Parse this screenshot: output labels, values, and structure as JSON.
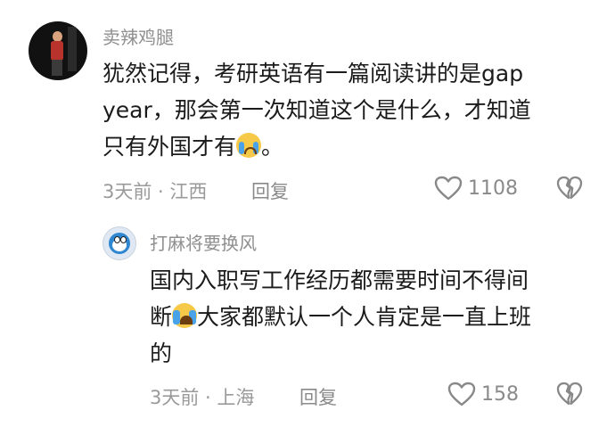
{
  "comment": {
    "username": "卖辣鸡腿",
    "text_line1": "犹然记得，考研英语有一篇阅读讲的是gap",
    "text_line2": "year，那会第一次知道这个是什么，才知道",
    "text_line3": "只有外国才有",
    "text_end": "。",
    "time_location": "3天前 · 江西",
    "reply_label": "回复",
    "likes": "1108"
  },
  "reply": {
    "username": "打麻将要换风",
    "text_line1": "国内入职写工作经历都需要时间不得间",
    "text_line2_a": "断",
    "text_line2_b": "大家都默认一个人肯定是一直上班",
    "text_line3": "的",
    "time_location": "3天前 · 上海",
    "reply_label": "回复",
    "likes": "158"
  },
  "icons": {
    "like": "heart-outline-icon",
    "dislike": "broken-heart-icon",
    "emoji_cry": "crying-face-emoji",
    "emoji_laugh_cry": "loudly-crying-face-emoji"
  }
}
